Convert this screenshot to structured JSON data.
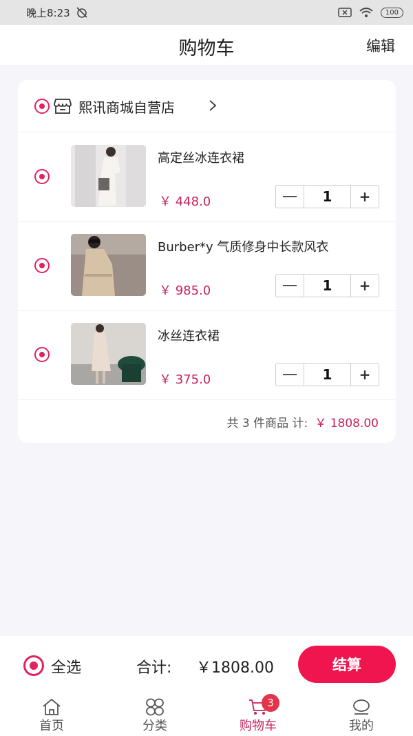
{
  "status_bar": {
    "time": "晚上8:23",
    "battery": "100"
  },
  "header": {
    "title": "购物车",
    "edit_label": "编辑"
  },
  "store": {
    "name": "熙讯商城自营店"
  },
  "items": [
    {
      "name": "高定丝冰连衣裙",
      "price": "￥ 448.0",
      "quantity": "1"
    },
    {
      "name": "Burber*y 气质修身中长款风衣",
      "price": "￥ 985.0",
      "quantity": "1"
    },
    {
      "name": "冰丝连衣裙",
      "price": "￥ 375.0",
      "quantity": "1"
    }
  ],
  "summary": {
    "text": "共 3 件商品  计:",
    "total": "￥ 1808.00"
  },
  "checkout": {
    "select_all_label": "全选",
    "total_label": "合计:",
    "total_value": "￥1808.00",
    "button_label": "结算"
  },
  "tabs": [
    {
      "label": "首页",
      "icon": "home-icon"
    },
    {
      "label": "分类",
      "icon": "category-icon"
    },
    {
      "label": "购物车",
      "icon": "cart-icon",
      "badge": "3",
      "active": true
    },
    {
      "label": "我的",
      "icon": "profile-icon"
    }
  ],
  "colors": {
    "accent": "#e3215f",
    "price": "#c8225a",
    "checkout_button": "#f0154f",
    "badge": "#e4344a"
  }
}
